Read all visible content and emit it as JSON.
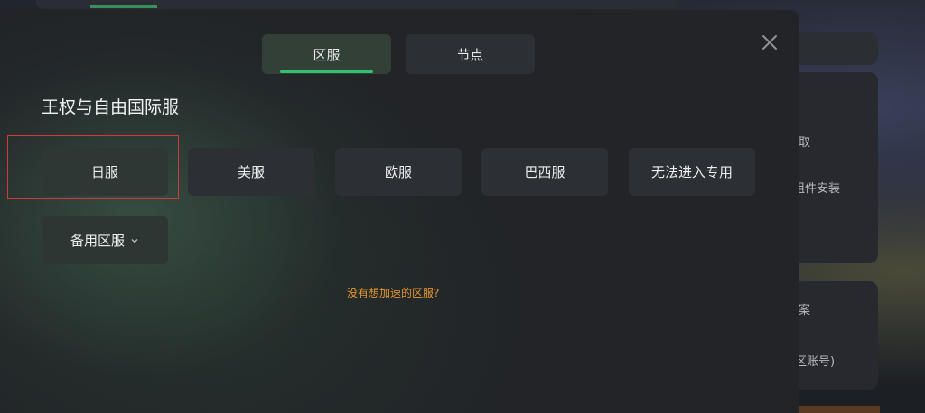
{
  "background": {
    "text_1": "取",
    "text_2": "组件安装",
    "text_3": "案",
    "text_4": "区账号)"
  },
  "modal": {
    "tabs": [
      {
        "label": "区服",
        "active": true
      },
      {
        "label": "节点",
        "active": false
      }
    ],
    "close_icon": "close-icon",
    "game_title": "王权与自由国际服",
    "regions": [
      {
        "label": "日服",
        "selected": true
      },
      {
        "label": "美服",
        "selected": false
      },
      {
        "label": "欧服",
        "selected": false
      },
      {
        "label": "巴西服",
        "selected": false
      },
      {
        "label": "无法进入专用",
        "selected": false
      }
    ],
    "backup_dropdown": {
      "label": "备用区服",
      "icon": "chevron-down-icon"
    },
    "missing_region_link": "没有想加速的区服?"
  },
  "colors": {
    "accent_green": "#2fc070",
    "link_orange": "#e5952e",
    "highlight_red": "#d23a3a"
  }
}
